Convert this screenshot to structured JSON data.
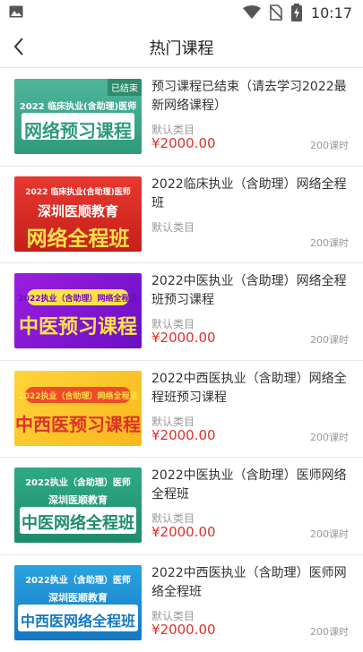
{
  "status": {
    "time": "10:17"
  },
  "nav": {
    "title": "热门课程"
  },
  "courses": [
    {
      "title": "预习课程已结束（请去学习2022最新网络课程）",
      "category": "默认类目",
      "price": "¥2000.00",
      "hours": "200课时",
      "banner": {
        "tag": "已结束",
        "top": "2022 临床执业(含助理)医师",
        "main": "网络预习课程"
      }
    },
    {
      "title": "2022临床执业（含助理）网络全程班",
      "category": "默认类目",
      "price": "",
      "hours": "200课时",
      "banner": {
        "top": "2022 临床执业(含助理)医师",
        "mid": "深圳医顺教育",
        "main": "网络全程班"
      }
    },
    {
      "title": "2022中医执业（含助理）网络全程班预习课程",
      "category": "默认类目",
      "price": "¥2000.00",
      "hours": "200课时",
      "banner": {
        "top": "2022执业（含助理）网络全程班",
        "main": "中医预习课程"
      }
    },
    {
      "title": "2022中西医执业（含助理）网络全程班预习课程",
      "category": "默认类目",
      "price": "¥2000.00",
      "hours": "200课时",
      "banner": {
        "top": "2022执业（含助理）网络全程班",
        "main": "中西医预习课程"
      }
    },
    {
      "title": "2022中医执业（含助理）医师网络全程班",
      "category": "默认类目",
      "price": "¥2000.00",
      "hours": "200课时",
      "banner": {
        "top": "2022执业（含助理）医师",
        "mid": "深圳医顺教育",
        "main": "中医网络全程班"
      }
    },
    {
      "title": "2022中西医执业（含助理）医师网络全程班",
      "category": "默认类目",
      "price": "¥2000.00",
      "hours": "200课时",
      "banner": {
        "top": "2022执业（含助理）医师",
        "mid": "深圳医顺教育",
        "main": "中西医网络全程班"
      }
    }
  ]
}
